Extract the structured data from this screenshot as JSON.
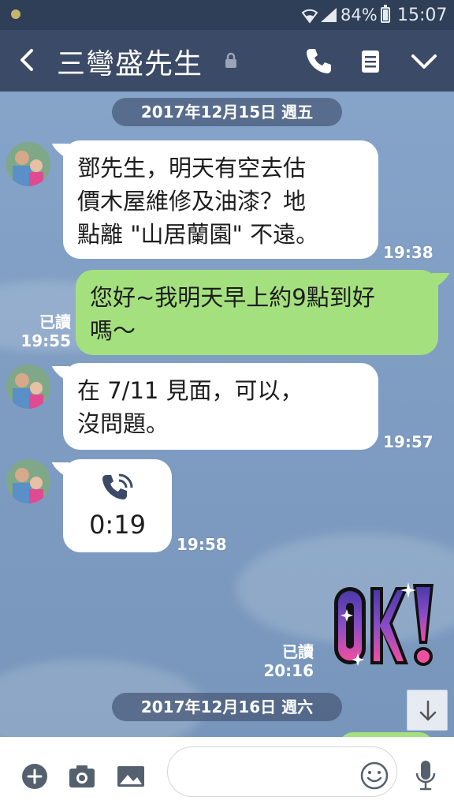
{
  "status_bar": {
    "battery": "84%",
    "time": "15:07"
  },
  "header": {
    "title": "三彎盛先生"
  },
  "chat": {
    "date1": "2017年12月15日 週五",
    "date2": "2017年12月16日 週六",
    "messages": [
      {
        "side": "in",
        "lines": [
          "鄧先生，明天有空去估",
          "價木屋維修及油漆？地",
          "點離 \"山居蘭園\" 不遠。"
        ],
        "time": "19:38"
      },
      {
        "side": "out",
        "lines": [
          "您好~我明天早上約9點到好",
          "嗎～"
        ],
        "read": "已讀",
        "time": "19:55"
      },
      {
        "side": "in",
        "lines": [
          "在 7/11 見面，可以，",
          "沒問題。"
        ],
        "time": "19:57"
      },
      {
        "side": "in",
        "type": "call",
        "duration": "0:19",
        "time": "19:58"
      },
      {
        "side": "out",
        "type": "sticker",
        "sticker_text": "OK!",
        "read": "已讀",
        "time": "20:16"
      }
    ]
  },
  "colors": {
    "header": "#3b4a66",
    "bubble_out": "#a5e07f",
    "bubble_in": "#ffffff"
  }
}
